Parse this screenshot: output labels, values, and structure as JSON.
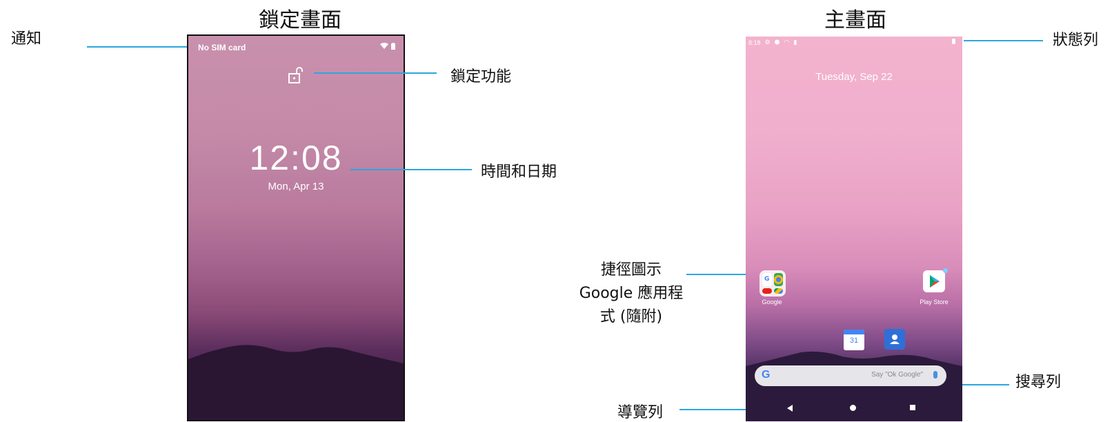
{
  "titles": {
    "lock": "鎖定畫面",
    "home": "主畫面"
  },
  "callouts": {
    "notification": "通知",
    "lock_feature": "鎖定功能",
    "time_date": "時間和日期",
    "shortcuts_line1": "捷徑圖示",
    "shortcuts_line2": "Google 應用程",
    "shortcuts_line3": "式 (隨附)",
    "navigation": "導覽列",
    "status_bar": "狀態列",
    "search_bar": "搜尋列"
  },
  "lock_screen": {
    "carrier": "No SIM card",
    "time": "12:08",
    "date": "Mon, Apr 13"
  },
  "home_screen": {
    "status_time": "8:18",
    "date": "Tuesday, Sep 22",
    "folder_label": "Google",
    "play_label": "Play Store",
    "calendar_day": "31",
    "search_logo": "G",
    "search_hint": "Say \"Ok Google\""
  },
  "colors": {
    "callout_line": "#2ba7df"
  }
}
